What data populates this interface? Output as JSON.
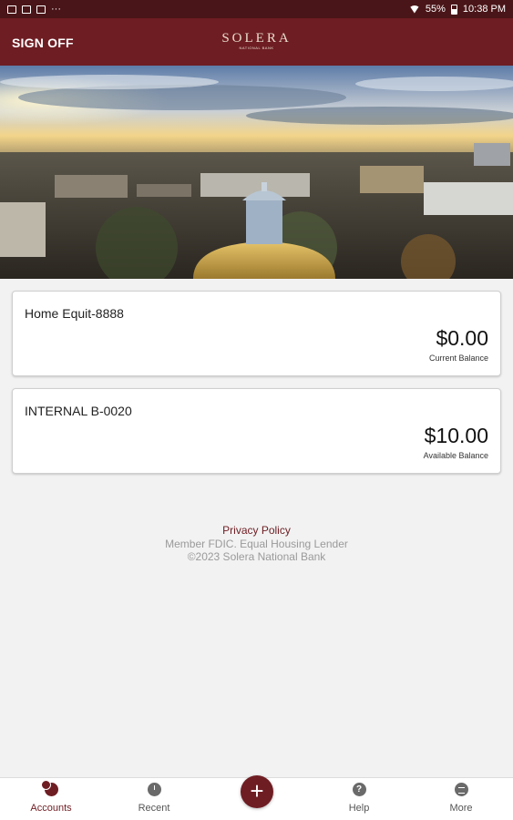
{
  "status_bar": {
    "notification_icons": [
      "image-icon",
      "mail-icon",
      "gmail-icon"
    ],
    "more": "···",
    "battery": "55%",
    "time": "10:38 PM"
  },
  "header": {
    "sign_off": "SIGN OFF",
    "logo_main": "SOLERA",
    "logo_sub": "NATIONAL BANK"
  },
  "accounts": [
    {
      "name": "Home Equit-8888",
      "amount": "$0.00",
      "balance_label": "Current Balance"
    },
    {
      "name": "INTERNAL B-0020",
      "amount": "$10.00",
      "balance_label": "Available Balance"
    }
  ],
  "footer": {
    "privacy": "Privacy Policy",
    "member": "Member FDIC. Equal Housing Lender",
    "copyright": "©2023 Solera National Bank"
  },
  "bottom_nav": {
    "items": [
      {
        "label": "Accounts",
        "icon": "accounts-icon",
        "active": true
      },
      {
        "label": "Recent",
        "icon": "clock-icon"
      },
      {
        "label": "Help",
        "icon": "help-icon",
        "glyph": "?"
      },
      {
        "label": "More",
        "icon": "more-icon"
      }
    ],
    "fab_glyph": "+"
  },
  "colors": {
    "brand": "#6e1d23",
    "status_bar": "#4a1518",
    "background": "#f2f2f2"
  }
}
